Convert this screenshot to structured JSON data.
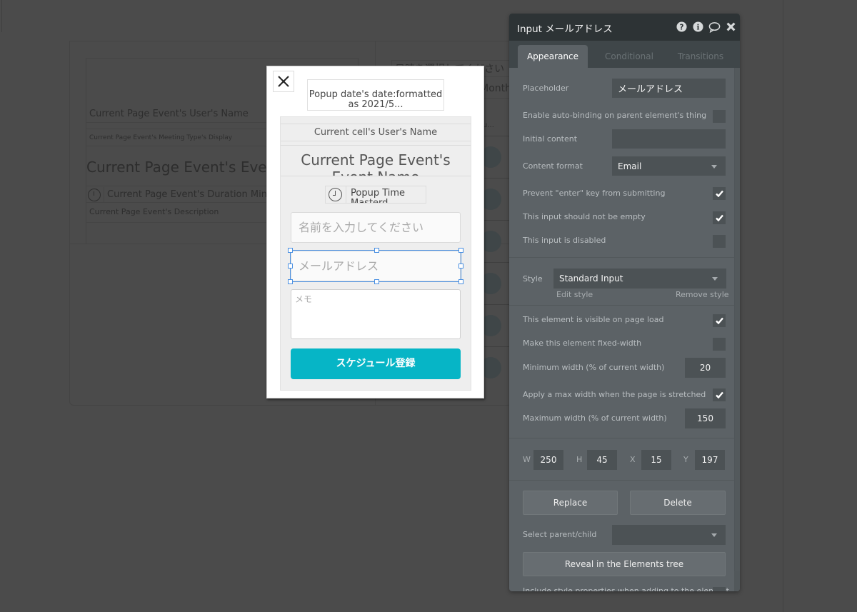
{
  "background_canvas": {
    "user_name": "Current Page Event's User's Name",
    "meeting_type": "Current Page Event's Meeting Type's Display",
    "event_name": "Current Page Event's Event Name",
    "duration": "Current Page Event's Duration Minutes",
    "description": "Current Page Event's Description",
    "right_title": "日時を選択してください",
    "right_month": "Month",
    "right_small": "u..."
  },
  "popup": {
    "close_label": "✕",
    "date_text": "Popup date's date:formatted as 2021/5...",
    "user_name": "Current cell's User's Name",
    "event_name": "Current Page Event's Event Name",
    "time_text": "Popup Time Masterd",
    "name_placeholder": "名前を入力してください",
    "email_placeholder": "メールアドレス",
    "memo_placeholder": "メモ",
    "submit_label": "スケジュール登録"
  },
  "panel": {
    "title": "Input メールアドレス",
    "header_icons": [
      "help-icon",
      "info-icon",
      "comment-icon",
      "close-icon"
    ],
    "tabs": [
      {
        "label": "Appearance",
        "active": true
      },
      {
        "label": "Conditional",
        "active": false
      },
      {
        "label": "Transitions",
        "active": false
      }
    ],
    "placeholder_label": "Placeholder",
    "placeholder_value": "メールアドレス",
    "auto_binding_label": "Enable auto-binding on parent element's thing",
    "auto_binding_checked": false,
    "initial_content_label": "Initial content",
    "initial_content_value": "",
    "content_format_label": "Content format",
    "content_format_value": "Email",
    "prevent_enter_label": "Prevent \"enter\" key from submitting",
    "prevent_enter_checked": true,
    "not_empty_label": "This input should not be empty",
    "not_empty_checked": true,
    "disabled_label": "This input is disabled",
    "disabled_checked": false,
    "style_label": "Style",
    "style_value": "Standard Input",
    "edit_style": "Edit style",
    "remove_style": "Remove style",
    "visible_label": "This element is visible on page load",
    "visible_checked": true,
    "fixed_width_label": "Make this element fixed-width",
    "fixed_width_checked": false,
    "min_width_label": "Minimum width (% of current width)",
    "min_width_value": "20",
    "apply_max_label": "Apply a max width when the page is stretched",
    "apply_max_checked": true,
    "max_width_label": "Maximum width (% of current width)",
    "max_width_value": "150",
    "geometry": {
      "w_label": "W",
      "w_value": "250",
      "h_label": "H",
      "h_value": "45",
      "x_label": "X",
      "x_value": "15",
      "y_label": "Y",
      "y_value": "197"
    },
    "replace_label": "Replace",
    "delete_label": "Delete",
    "select_parent_label": "Select parent/child",
    "select_parent_value": "",
    "reveal_label": "Reveal in the Elements tree",
    "cut_off_label": "Include style properties when adding to the element"
  },
  "colors": {
    "canvas_bg": "#4b4b4b",
    "panel_bg": "#5c6266",
    "panel_header": "#2d3335",
    "field_bg": "#4c5255",
    "submit_button": "#06b5c6",
    "selection": "#4a90e2"
  }
}
